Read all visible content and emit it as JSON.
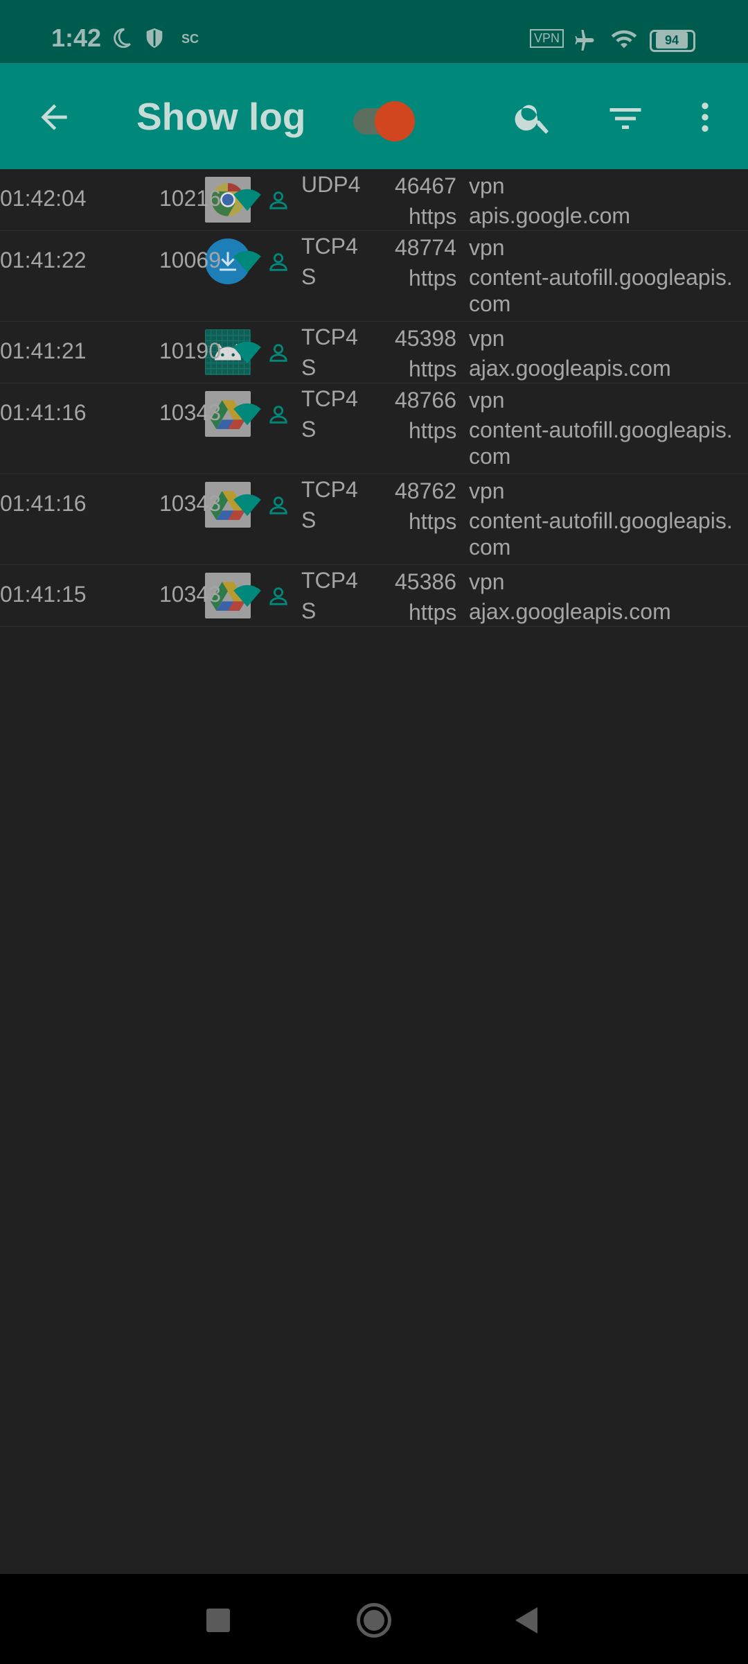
{
  "status": {
    "time": "1:42",
    "sc_label": "SC",
    "vpn_label": "VPN",
    "battery": "94"
  },
  "appbar": {
    "title": "Show log",
    "toggle_on": true
  },
  "log": [
    {
      "time": "01:42:04",
      "app": "chrome",
      "uid": "10216",
      "proto_line1": "UDP4",
      "proto_line2": "",
      "port": "46467",
      "tag": "vpn",
      "service": "https",
      "host_line1": "apis.google.com",
      "host_line2": ""
    },
    {
      "time": "01:41:22",
      "app": "download",
      "uid": "10069",
      "proto_line1": "TCP4",
      "proto_line2": "S",
      "port": "48774",
      "tag": "vpn",
      "service": "https",
      "host_line1": "content-autofill.googleapis.",
      "host_line2": "com"
    },
    {
      "time": "01:41:21",
      "app": "android",
      "uid": "10190",
      "proto_line1": "TCP4",
      "proto_line2": "S",
      "port": "45398",
      "tag": "vpn",
      "service": "https",
      "host_line1": "ajax.googleapis.com",
      "host_line2": ""
    },
    {
      "time": "01:41:16",
      "app": "drive",
      "uid": "10343",
      "proto_line1": "TCP4",
      "proto_line2": "S",
      "port": "48766",
      "tag": "vpn",
      "service": "https",
      "host_line1": "content-autofill.googleapis.",
      "host_line2": "com"
    },
    {
      "time": "01:41:16",
      "app": "drive",
      "uid": "10343",
      "proto_line1": "TCP4",
      "proto_line2": "S",
      "port": "48762",
      "tag": "vpn",
      "service": "https",
      "host_line1": "content-autofill.googleapis.",
      "host_line2": "com"
    },
    {
      "time": "01:41:15",
      "app": "drive",
      "uid": "10343",
      "proto_line1": "TCP4",
      "proto_line2": "S",
      "port": "45386",
      "tag": "vpn",
      "service": "https",
      "host_line1": "ajax.googleapis.com",
      "host_line2": ""
    }
  ],
  "colors": {
    "accent": "#00897b",
    "statusbar": "#005b4f",
    "toggle": "#d1461f",
    "wifi": "#00897b"
  }
}
